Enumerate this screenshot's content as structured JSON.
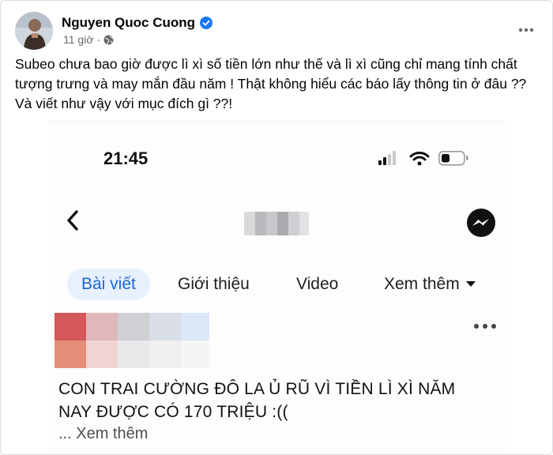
{
  "post": {
    "author": "Nguyen Quoc Cuong",
    "time": "11 giờ",
    "separator": "·",
    "icons": {
      "avatar": "profile-photo",
      "verified": "verified-badge-icon",
      "privacy": "globe-icon",
      "more": "more-horizontal-icon"
    },
    "text": "Subeo chưa bao giờ được lì xì số tiền lớn như thế và lì xì cũng chỉ mang tính chất tượng trưng và may mắn đầu năm ! Thật không hiểu các báo lấy thông tin ở đâu ?? Và viết như vậy với mục đích gì ??!"
  },
  "screenshot": {
    "status_bar": {
      "time": "21:45",
      "icons": [
        "cellular-signal-icon",
        "wifi-icon",
        "battery-icon"
      ]
    },
    "nav": {
      "back_icon": "chevron-left-icon",
      "title": "blurred-name",
      "messenger_icon": "messenger-icon"
    },
    "tabs": [
      {
        "label": "Bài viết",
        "active": true
      },
      {
        "label": "Giới thiệu",
        "active": false
      },
      {
        "label": "Video",
        "active": false
      },
      {
        "label": "Xem thêm",
        "active": false
      }
    ],
    "item": {
      "avatar": "blurred-avatar",
      "more_icon": "more-horizontal-icon",
      "text": "CON TRAI CƯỜNG ĐÔ LA Ủ RŨ VÌ TIỀN LÌ XÌ NĂM NAY ĐƯỢC CÓ 170 TRIỆU :((",
      "see_more": "... Xem thêm"
    }
  },
  "colors": {
    "facebook_blue": "#1877f2",
    "tab_active_text": "#1b66d6",
    "tab_active_bg": "#e7f0fd",
    "secondary_text": "#65676b"
  }
}
